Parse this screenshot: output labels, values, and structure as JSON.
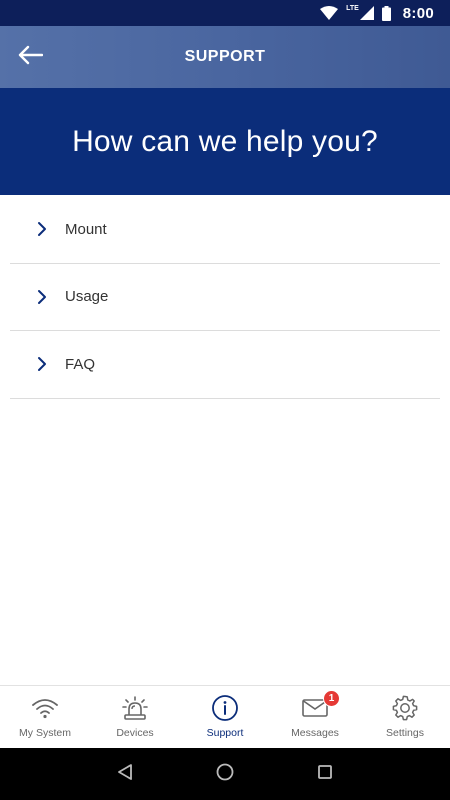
{
  "status_bar": {
    "time": "8:00",
    "network": "LTE",
    "icons": [
      "wifi-icon",
      "cellular-signal-icon",
      "battery-icon"
    ]
  },
  "app_bar": {
    "title": "SUPPORT",
    "back_icon": "back-arrow-icon"
  },
  "hero": {
    "heading": "How can we help you?"
  },
  "support_items": [
    {
      "label": "Mount",
      "icon": "chevron-right-icon"
    },
    {
      "label": "Usage",
      "icon": "chevron-right-icon"
    },
    {
      "label": "FAQ",
      "icon": "chevron-right-icon"
    }
  ],
  "bottom_nav": {
    "items": [
      {
        "label": "My System",
        "icon": "wifi-icon",
        "active": false
      },
      {
        "label": "Devices",
        "icon": "siren-icon",
        "active": false
      },
      {
        "label": "Support",
        "icon": "info-icon",
        "active": true
      },
      {
        "label": "Messages",
        "icon": "envelope-icon",
        "active": false,
        "badge": "1"
      },
      {
        "label": "Settings",
        "icon": "gear-icon",
        "active": false
      }
    ]
  },
  "system_nav": [
    "back-triangle-icon",
    "home-circle-icon",
    "recents-square-icon"
  ],
  "colors": {
    "status_bar": "#0d1f5a",
    "app_bar": "#4a66a0",
    "hero": "#0b2d7a",
    "accent": "#0b2d7a",
    "badge": "#e53935"
  }
}
